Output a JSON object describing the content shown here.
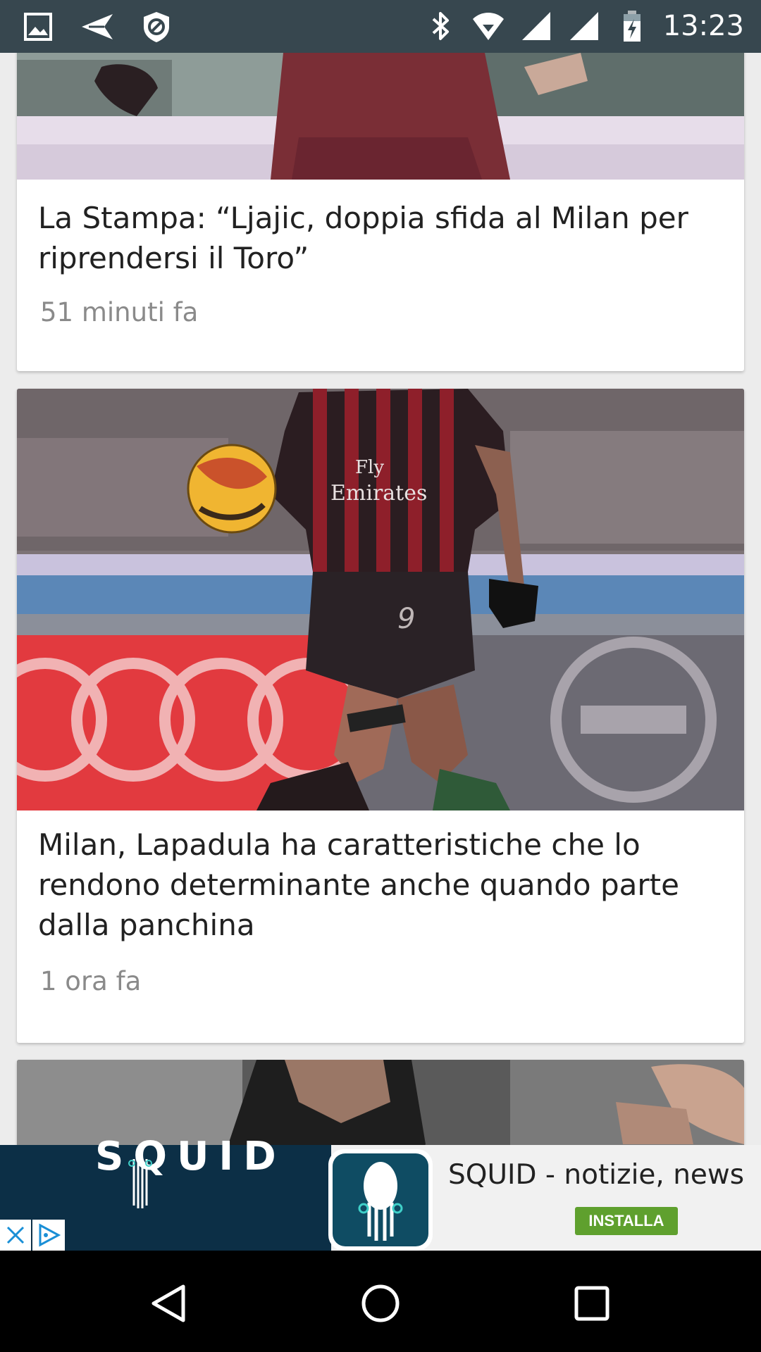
{
  "status_bar": {
    "time": "13:23",
    "left_icons": [
      "image-icon",
      "send-icon",
      "shield-icon"
    ],
    "right_icons": [
      "bluetooth-icon",
      "wifi-icon",
      "signal-icon",
      "signal-icon",
      "battery-charging-icon"
    ]
  },
  "feed": {
    "cards": [
      {
        "title": "La Stampa: “Ljajic, doppia sfida al Milan per riprendersi il Toro”",
        "time": "51 minuti fa",
        "image": "soccer-player-photo"
      },
      {
        "title": "Milan, Lapadula ha caratteristiche che lo rendono determinante anche quando parte dalla panchina",
        "time": "1 ora fa",
        "image": "soccer-player-photo"
      },
      {
        "image": "coach-photo"
      }
    ]
  },
  "ad": {
    "brand": "SQUID",
    "title": "SQUID - notizie, news",
    "cta": "INSTALLA"
  },
  "colors": {
    "status_bar": "#37474f",
    "cta_green": "#5fa02e",
    "ad_dark": "#0c2f46"
  }
}
